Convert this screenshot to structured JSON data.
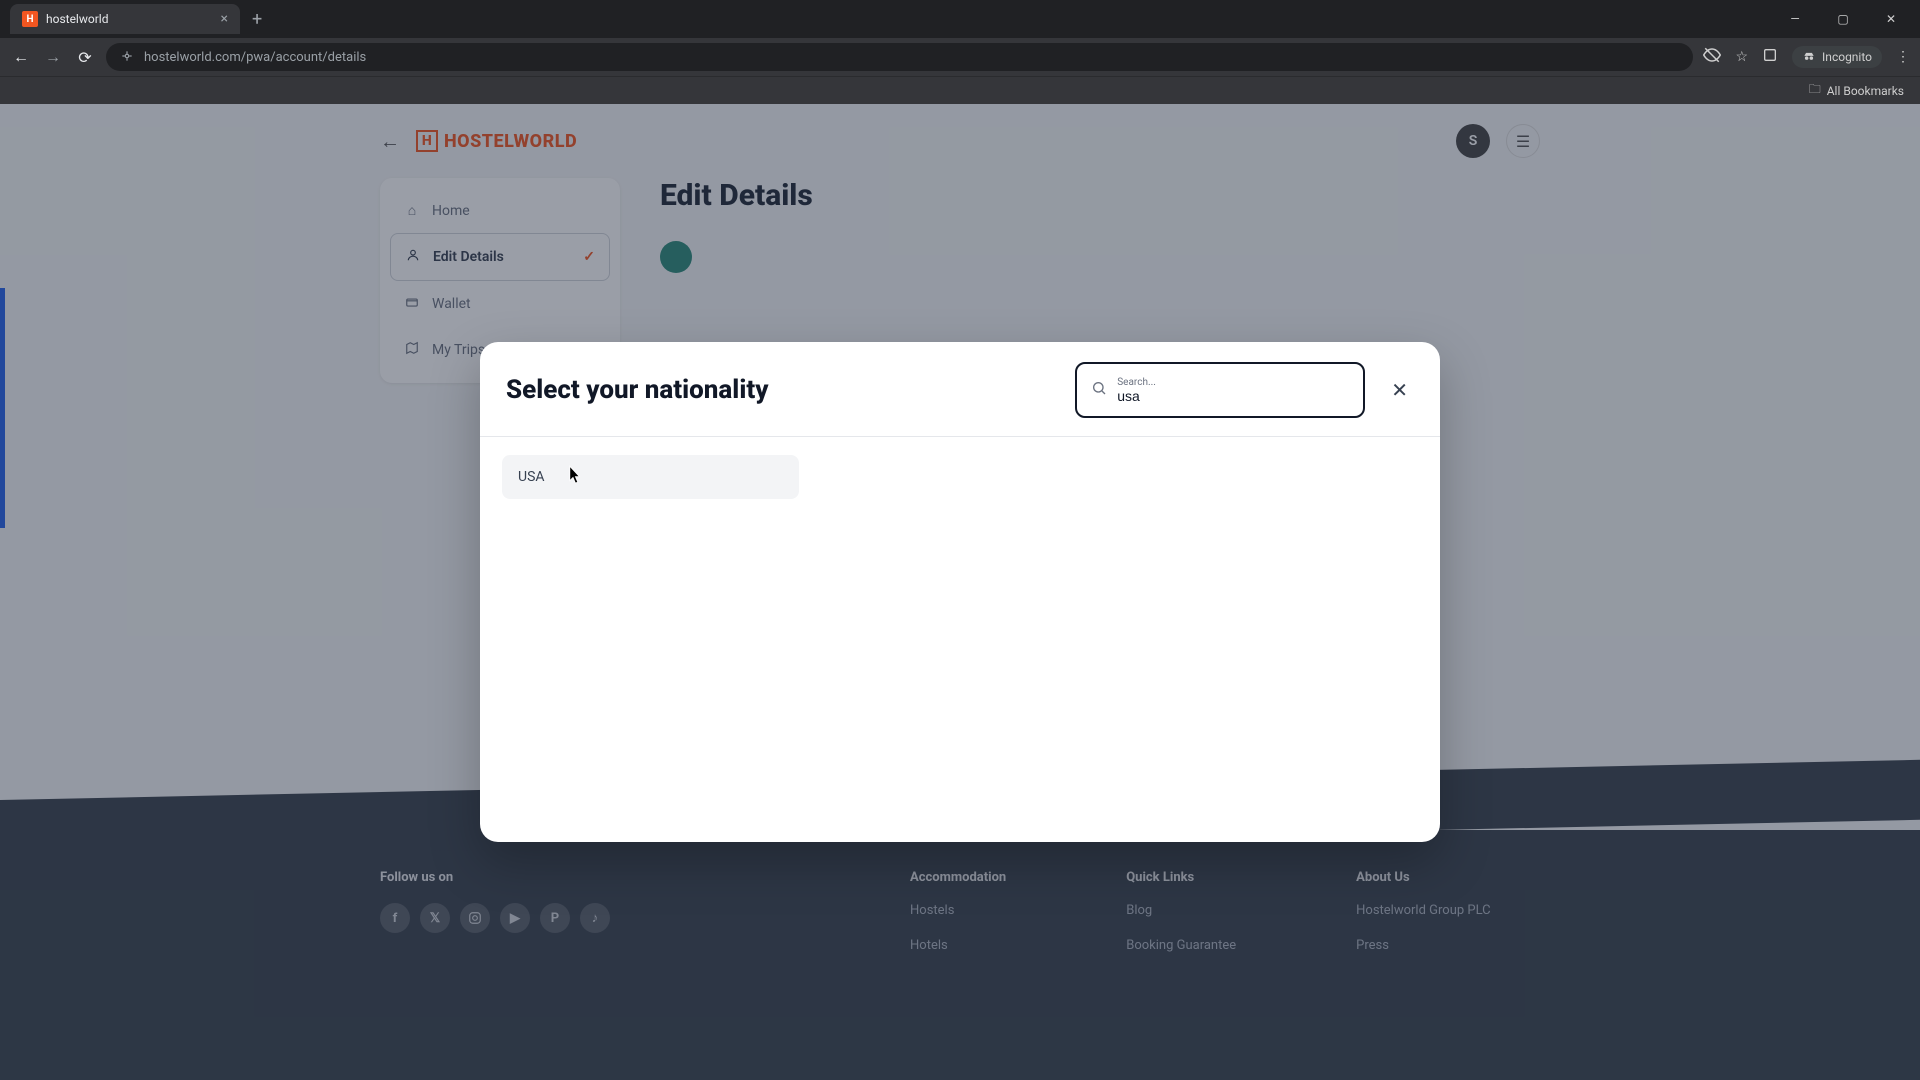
{
  "browser": {
    "tab_title": "hostelworld",
    "url": "hostelworld.com/pwa/account/details",
    "incognito_label": "Incognito",
    "all_bookmarks": "All Bookmarks"
  },
  "header": {
    "brand": "HOSTELWORLD",
    "avatar_letter": "S"
  },
  "sidebar": {
    "items": [
      {
        "label": "Home"
      },
      {
        "label": "Edit Details"
      },
      {
        "label": "Wallet"
      },
      {
        "label": "My Trips"
      }
    ]
  },
  "page": {
    "title": "Edit Details"
  },
  "modal": {
    "title": "Select your nationality",
    "search_placeholder": "Search...",
    "search_value": "usa",
    "results": [
      "USA"
    ]
  },
  "footer": {
    "follow": "Follow us on",
    "cols": [
      {
        "title": "Accommodation",
        "links": [
          "Hostels",
          "Hotels"
        ]
      },
      {
        "title": "Quick Links",
        "links": [
          "Blog",
          "Booking Guarantee"
        ]
      },
      {
        "title": "About Us",
        "links": [
          "Hostelworld Group PLC",
          "Press"
        ]
      }
    ]
  }
}
